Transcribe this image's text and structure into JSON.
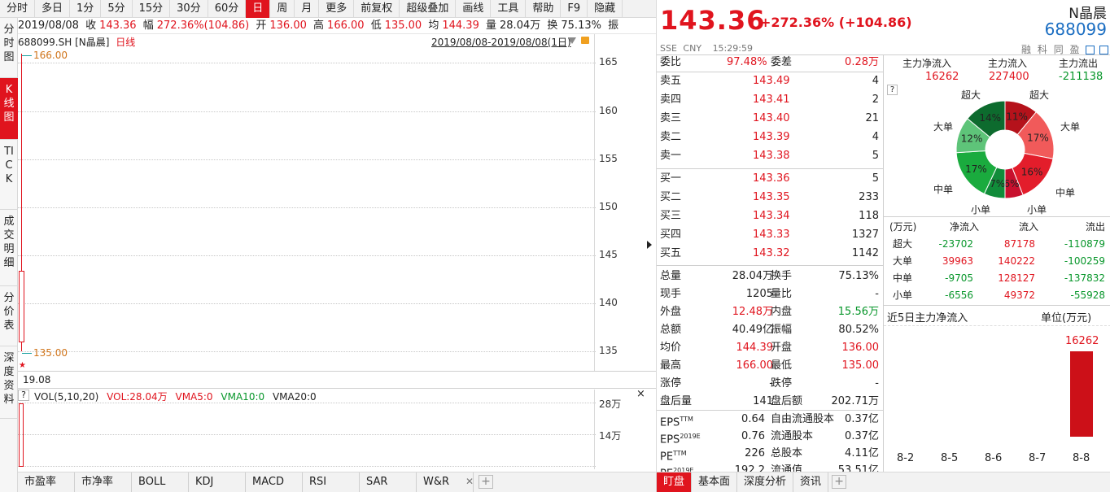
{
  "toolbar": {
    "items": [
      "分时",
      "多日",
      "1分",
      "5分",
      "15分",
      "30分",
      "60分",
      "日",
      "周",
      "月",
      "更多",
      "前复权",
      "超级叠加",
      "画线",
      "工具",
      "帮助",
      "F9",
      "隐藏"
    ],
    "active": "日"
  },
  "leftnav": {
    "items": [
      "分时图",
      "K线图",
      "TICK",
      "成交明细",
      "分价表",
      "深度资料"
    ]
  },
  "infobar": {
    "date": "2019/08/08",
    "close_lbl": "收",
    "close": "143.36",
    "amp_lbl": "幅",
    "amp": "272.36%(104.86)",
    "open_lbl": "开",
    "open": "136.00",
    "high_lbl": "高",
    "high": "166.00",
    "low_lbl": "低",
    "low": "135.00",
    "avg_lbl": "均",
    "avg": "144.39",
    "vol_lbl": "量",
    "vol": "28.04万",
    "turn_lbl": "换",
    "turn": "75.13%",
    "zhen": "振"
  },
  "chart": {
    "symbol": "688099.SH [N晶晨]",
    "period": "日线",
    "range": "2019/08/08-2019/08/08(1日)",
    "high_label": "166.00",
    "low_label": "135.00",
    "yticks": [
      "165",
      "160",
      "155",
      "150",
      "145",
      "140",
      "135"
    ],
    "date_label": "19.08",
    "candle": {
      "open": 136.0,
      "high": 166.0,
      "low": 135.0,
      "close": 143.36
    },
    "ymin": 133,
    "ymax": 168
  },
  "vol": {
    "help": "?",
    "title": "VOL(5,10,20)",
    "vol": "VOL:28.04万",
    "vma5": "VMA5:0",
    "vma10": "VMA10:0",
    "vma20": "VMA20:0",
    "yticks": [
      "28万",
      "14万"
    ],
    "close": "×"
  },
  "bottomtabs": [
    "市盈率",
    "市净率",
    "BOLL",
    "KDJ",
    "MACD",
    "RSI",
    "SAR",
    "W&R"
  ],
  "quote": {
    "price": "143.36",
    "change_pct": "+272.36%",
    "change_abs": "(+104.86)",
    "name": "N晶晨",
    "code": "688099",
    "exchange": "SSE",
    "currency": "CNY",
    "time": "15:29:59",
    "icons": [
      "融",
      "科",
      "同",
      "盈"
    ],
    "weibi_lbl": "委比",
    "weibi": "97.48%",
    "weicha_lbl": "委差",
    "weicha": "0.28万",
    "asks": [
      {
        "l": "卖五",
        "p": "143.49",
        "v": "4"
      },
      {
        "l": "卖四",
        "p": "143.41",
        "v": "2"
      },
      {
        "l": "卖三",
        "p": "143.40",
        "v": "21"
      },
      {
        "l": "卖二",
        "p": "143.39",
        "v": "4"
      },
      {
        "l": "卖一",
        "p": "143.38",
        "v": "5"
      }
    ],
    "bids": [
      {
        "l": "买一",
        "p": "143.36",
        "v": "5"
      },
      {
        "l": "买二",
        "p": "143.35",
        "v": "233"
      },
      {
        "l": "买三",
        "p": "143.34",
        "v": "118"
      },
      {
        "l": "买四",
        "p": "143.33",
        "v": "1327"
      },
      {
        "l": "买五",
        "p": "143.32",
        "v": "1142"
      }
    ],
    "stats": [
      {
        "l1": "总量",
        "v1": "28.04万",
        "c1": "",
        "l2": "换手",
        "v2": "75.13%",
        "c2": ""
      },
      {
        "l1": "现手",
        "v1": "1205",
        "c1": "",
        "l2": "量比",
        "v2": "-",
        "c2": ""
      },
      {
        "l1": "外盘",
        "v1": "12.48万",
        "c1": "red",
        "l2": "内盘",
        "v2": "15.56万",
        "c2": "green"
      },
      {
        "l1": "总额",
        "v1": "40.49亿",
        "c1": "",
        "l2": "振幅",
        "v2": "80.52%",
        "c2": ""
      },
      {
        "l1": "均价",
        "v1": "144.39",
        "c1": "red",
        "l2": "开盘",
        "v2": "136.00",
        "c2": "red"
      },
      {
        "l1": "最高",
        "v1": "166.00",
        "c1": "red",
        "l2": "最低",
        "v2": "135.00",
        "c2": "red"
      },
      {
        "l1": "涨停",
        "v1": "-",
        "c1": "",
        "l2": "跌停",
        "v2": "-",
        "c2": ""
      },
      {
        "l1": "盘后量",
        "v1": "141",
        "c1": "",
        "l2": "盘后额",
        "v2": "202.71万",
        "c2": ""
      }
    ],
    "fin": [
      {
        "l1": "EPS",
        "s1": "TTM",
        "v1": "0.64",
        "l2": "自由流通股本",
        "v2": "0.37亿"
      },
      {
        "l1": "EPS",
        "s1": "2019E",
        "v1": "0.76",
        "l2": "流通股本",
        "v2": "0.37亿"
      },
      {
        "l1": "PE",
        "s1": "TTM",
        "v1": "226",
        "l2": "总股本",
        "v2": "4.11亿"
      },
      {
        "l1": "PE",
        "s1": "2019E",
        "v1": "192.2",
        "l2": "流通值",
        "v2": "53.51亿"
      }
    ]
  },
  "flow": {
    "h1": "主力净流入",
    "h2": "主力流入",
    "h3": "主力流出",
    "v1": "16262",
    "v2": "227400",
    "v3": "-211138",
    "help": "?",
    "pie": {
      "outer_labels": [
        "超大",
        "超大",
        "大单",
        "大单",
        "中单",
        "中单",
        "小单",
        "小单"
      ],
      "slices": [
        {
          "pct": "11%",
          "value": 11,
          "color": "#b5121b"
        },
        {
          "pct": "17%",
          "value": 17,
          "color": "#f15a5a"
        },
        {
          "pct": "16%",
          "value": 16,
          "color": "#e31d2b"
        },
        {
          "pct": "6%",
          "value": 6,
          "color": "#c8102e"
        },
        {
          "pct": "7%",
          "value": 7,
          "color": "#118c3a"
        },
        {
          "pct": "17%",
          "value": 17,
          "color": "#1aab3e"
        },
        {
          "pct": "12%",
          "value": 12,
          "color": "#5ec479"
        },
        {
          "pct": "14%",
          "value": 14,
          "color": "#0d6b2e"
        }
      ]
    },
    "table": {
      "headers": [
        "(万元)",
        "净流入",
        "流入",
        "流出"
      ],
      "rows": [
        {
          "t": "超大",
          "n": "-23702",
          "i": "87178",
          "o": "-110879"
        },
        {
          "t": "大单",
          "n": "39963",
          "i": "140222",
          "o": "-100259"
        },
        {
          "t": "中单",
          "n": "-9705",
          "i": "128127",
          "o": "-137832"
        },
        {
          "t": "小单",
          "n": "-6556",
          "i": "49372",
          "o": "-55928"
        }
      ]
    },
    "five_day": {
      "title": "近5日主力净流入",
      "unit": "单位(万元)",
      "days": [
        "8-2",
        "8-5",
        "8-6",
        "8-7",
        "8-8"
      ],
      "values": [
        0,
        0,
        0,
        0,
        16262
      ],
      "label": "16262"
    }
  },
  "rtabs": [
    "盯盘",
    "基本面",
    "深度分析",
    "资讯"
  ]
}
